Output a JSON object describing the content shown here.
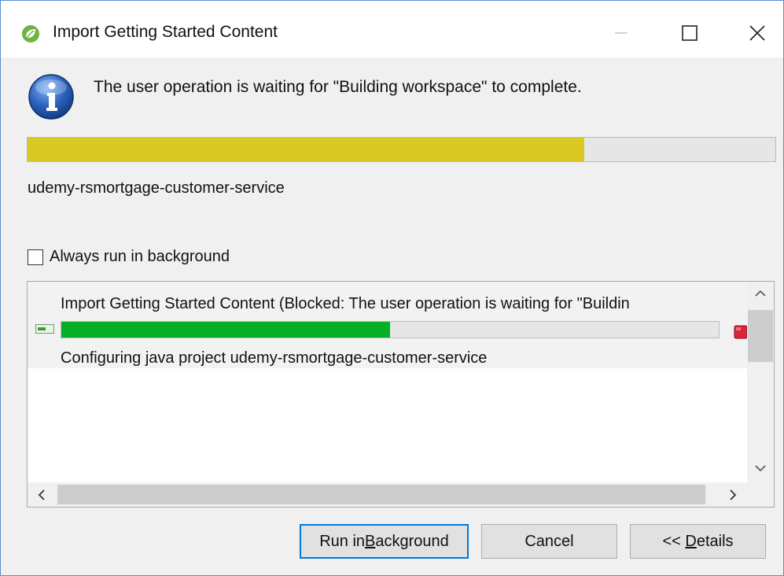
{
  "window": {
    "title": "Import Getting Started Content"
  },
  "message": "The user operation is waiting for \"Building workspace\" to complete.",
  "main_progress": {
    "fraction": 0.745,
    "color": "#dac925"
  },
  "task_name": "udemy-rsmortgage-customer-service",
  "background_checkbox": {
    "label": "Always run in background",
    "checked": false
  },
  "details": {
    "job": {
      "title": "Import Getting Started Content (Blocked: The user operation is waiting for \"Buildin",
      "progress": 0.5,
      "progress_color": "#06b025",
      "subtask": "Configuring java project udemy-rsmortgage-customer-service"
    }
  },
  "buttons": {
    "run_prefix": "Run in ",
    "run_mnemonic": "B",
    "run_suffix": "ackground",
    "cancel": "Cancel",
    "details_prefix": "<< ",
    "details_mnemonic": "D",
    "details_suffix": "etails"
  },
  "icons": {
    "app": "spring-leaf-icon",
    "info": "info-icon",
    "job": "job-status-icon",
    "stop": "stop-icon"
  },
  "colors": {
    "accent_focus": "#0078d7",
    "info_blue": "#1f4fa3",
    "stop_red": "#d9253a"
  }
}
